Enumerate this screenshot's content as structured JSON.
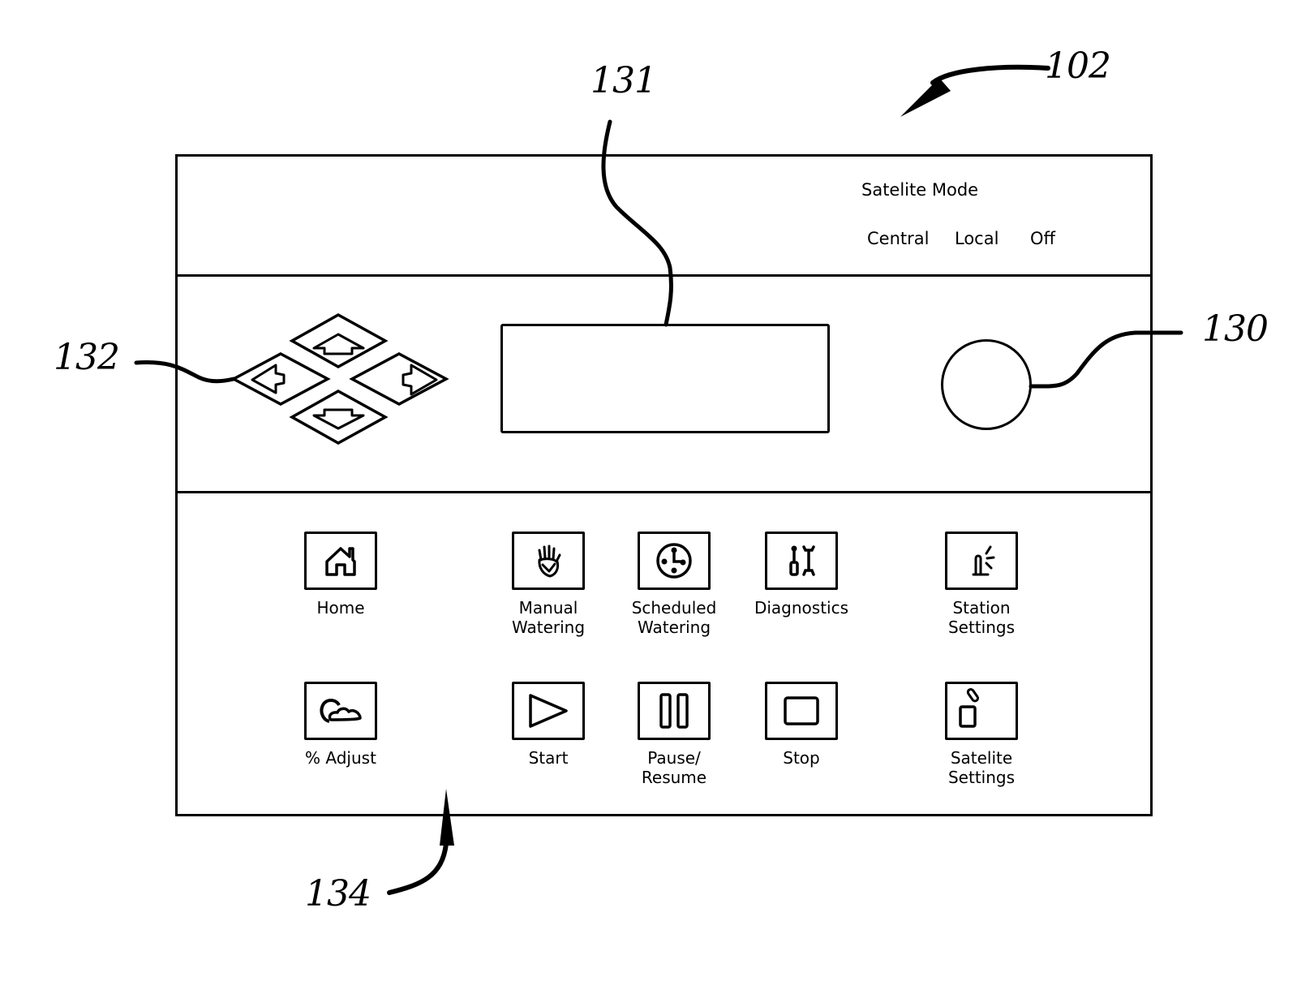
{
  "figure": {
    "reference_numerals": {
      "device": "102",
      "display": "131",
      "knob": "130",
      "arrow_keys": "132",
      "button_panel": "134"
    }
  },
  "satellite_mode": {
    "title": "Satelite Mode",
    "options": [
      "Central",
      "Local",
      "Off"
    ]
  },
  "navigation_pad": {
    "keys": [
      {
        "direction": "up",
        "icon": "arrow-up-icon"
      },
      {
        "direction": "left",
        "icon": "arrow-left-icon"
      },
      {
        "direction": "right",
        "icon": "arrow-right-icon"
      },
      {
        "direction": "down",
        "icon": "arrow-down-icon"
      }
    ]
  },
  "buttons": {
    "row1": [
      {
        "id": "home",
        "label_lines": [
          "Home"
        ],
        "icon": "house-icon"
      },
      {
        "id": "manual-watering",
        "label_lines": [
          "Manual",
          "Watering"
        ],
        "icon": "hand-icon"
      },
      {
        "id": "scheduled-watering",
        "label_lines": [
          "Scheduled",
          "Watering"
        ],
        "icon": "clock-icon"
      },
      {
        "id": "diagnostics",
        "label_lines": [
          "Diagnostics"
        ],
        "icon": "tools-icon"
      },
      {
        "id": "station-settings",
        "label_lines": [
          "Station",
          "Settings"
        ],
        "icon": "sprinkler-icon"
      }
    ],
    "row2": [
      {
        "id": "percent-adjust",
        "label_lines": [
          "% Adjust"
        ],
        "icon": "sun-cloud-icon"
      },
      {
        "id": "start",
        "label_lines": [
          "Start"
        ],
        "icon": "play-icon"
      },
      {
        "id": "pause-resume",
        "label_lines": [
          "Pause/",
          "Resume"
        ],
        "icon": "pause-icon"
      },
      {
        "id": "stop",
        "label_lines": [
          "Stop"
        ],
        "icon": "stop-icon"
      },
      {
        "id": "satelite-settings",
        "label_lines": [
          "Satelite",
          "Settings"
        ],
        "icon": "satellite-device-icon"
      }
    ]
  }
}
